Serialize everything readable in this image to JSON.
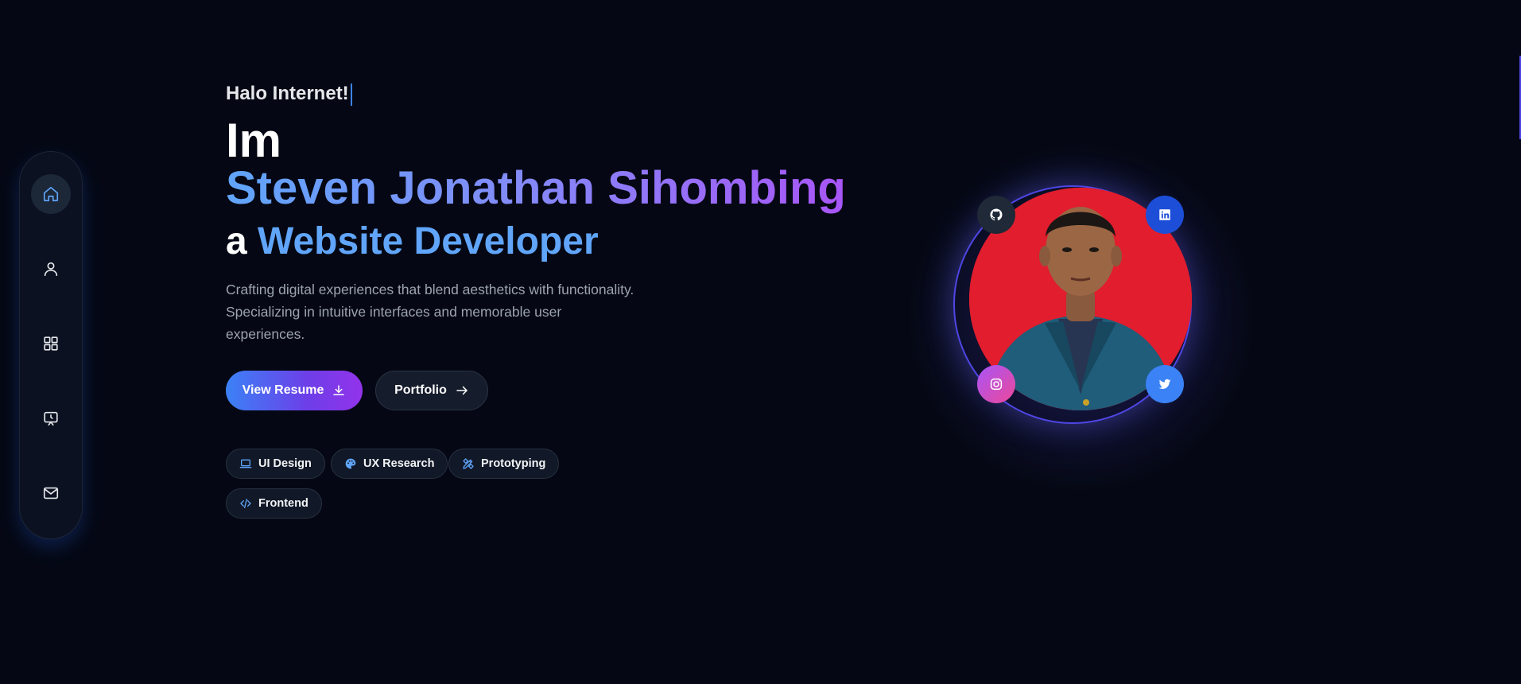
{
  "sidebar": {
    "items": [
      {
        "name": "home",
        "icon": "home-icon",
        "active": true
      },
      {
        "name": "about",
        "icon": "user-icon",
        "active": false
      },
      {
        "name": "projects",
        "icon": "grid-icon",
        "active": false
      },
      {
        "name": "experience",
        "icon": "clock-screen-icon",
        "active": false
      },
      {
        "name": "contact",
        "icon": "mail-icon",
        "active": false
      }
    ]
  },
  "hero": {
    "greeting": "Halo Internet!",
    "intro": "Im",
    "name": "Steven Jonathan Sihombing",
    "role_prefix": "a",
    "role": "Website Developer",
    "description": "Crafting digital experiences that blend aesthetics with functionality. Specializing in intuitive interfaces and memorable user experiences."
  },
  "buttons": {
    "resume_label": "View Resume",
    "portfolio_label": "Portfolio"
  },
  "tags": [
    {
      "label": "UI Design",
      "icon": "laptop-icon"
    },
    {
      "label": "UX Research",
      "icon": "palette-icon"
    },
    {
      "label": "Prototyping",
      "icon": "pen-ruler-icon"
    },
    {
      "label": "Frontend",
      "icon": "code-icon"
    }
  ],
  "socials": [
    {
      "name": "github",
      "icon": "github-icon"
    },
    {
      "name": "linkedin",
      "icon": "linkedin-icon"
    },
    {
      "name": "instagram",
      "icon": "instagram-icon"
    },
    {
      "name": "twitter",
      "icon": "twitter-icon"
    }
  ],
  "colors": {
    "background": "#050814",
    "accent_blue": "#60a5fa",
    "accent_purple": "#a855f7",
    "photo_background": "#e11d2e"
  }
}
